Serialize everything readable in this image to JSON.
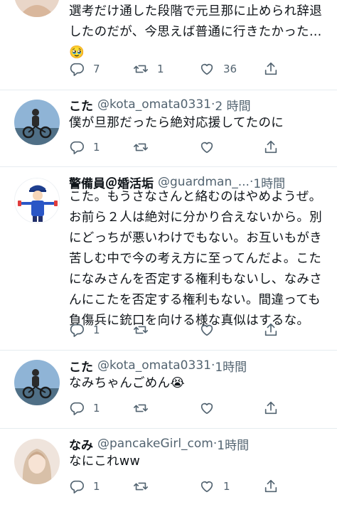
{
  "tweets": [
    {
      "text_lines": [
        "選考だけ通した段階で元旦那に止められ辞退",
        "したのだが、今思えば普通に行きたかった…",
        "🥹"
      ],
      "reply_count": "7",
      "retweet_count": "1",
      "like_count": "36",
      "avatar": "woman-avatar"
    },
    {
      "name": "こた",
      "handle": "@kota_omata0331",
      "separator": "·",
      "time": "2 時間",
      "text_lines": [
        "僕が旦那だったら絶対応援してたのに"
      ],
      "reply_count": "1",
      "retweet_count": "",
      "like_count": "",
      "avatar": "cyclist-avatar"
    },
    {
      "name": "警備員＠婚活垢",
      "handle": "@guardman_...",
      "separator": "·",
      "time": "1時間",
      "text_lines": [
        "こた。もうさなさんと絡むのはやめようぜ。",
        "お前ら２人は絶対に分かり合えないから。別",
        "にどっちが悪いわけでもない。お互いもがき",
        "苦しむ中で今の考え方に至ってんだよ。こた",
        "になみさんを否定する権利もないし、なみさ",
        "んにこたを否定する権利もない。間違っても",
        "負傷兵に銃口を向ける様な真似はするな。"
      ],
      "reply_count": "1",
      "retweet_count": "",
      "like_count": "",
      "avatar": "security-guard-avatar"
    },
    {
      "name": "こた",
      "handle": "@kota_omata0331",
      "separator": "·",
      "time": "1時間",
      "text_lines": [
        "なみちゃんごめん😭"
      ],
      "reply_count": "1",
      "retweet_count": "",
      "like_count": "",
      "avatar": "cyclist-avatar"
    },
    {
      "name": "なみ",
      "handle": "@pancakeGirl_com",
      "separator": "·",
      "time": "1時間",
      "text_lines": [
        "なにこれww"
      ],
      "reply_count": "1",
      "retweet_count": "",
      "like_count": "1",
      "avatar": "woman-avatar"
    }
  ]
}
